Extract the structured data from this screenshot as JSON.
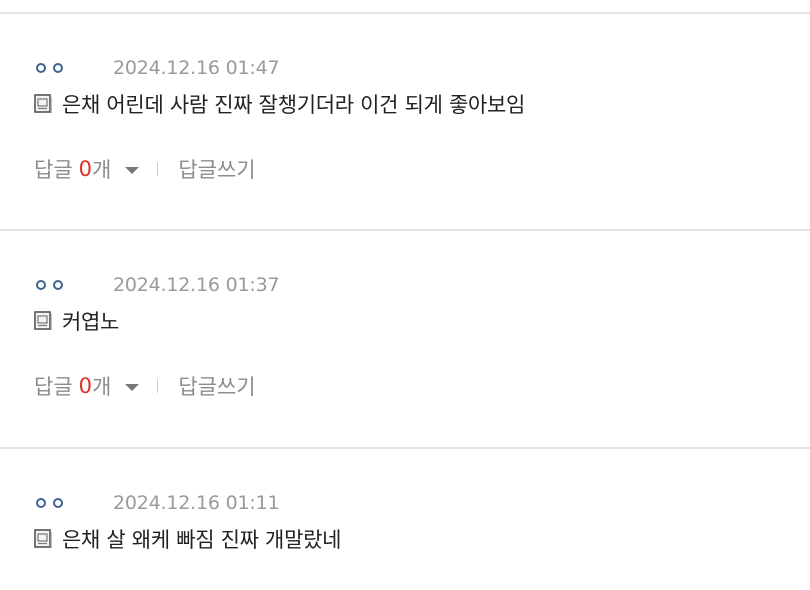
{
  "comments": [
    {
      "nickname": "ㅇㅇ",
      "date": "2024.12.16 01:47",
      "text": "은채 어린데 사람 진짜 잘챙기더라 이건 되게 좋아보임",
      "reply_label": "답글",
      "reply_count": "0",
      "reply_unit": "개",
      "write_reply": "답글쓰기",
      "has_actions": true
    },
    {
      "nickname": "ㅇㅇ",
      "date": "2024.12.16 01:37",
      "text": "커엽노",
      "reply_label": "답글",
      "reply_count": "0",
      "reply_unit": "개",
      "write_reply": "답글쓰기",
      "has_actions": true
    },
    {
      "nickname": "ㅇㅇ",
      "date": "2024.12.16 01:11",
      "text": "은채 살 왜케 빠짐 진짜 개말랐네"
    }
  ],
  "colors": {
    "nickname": "#3d5f8c",
    "date": "#9a9a9a",
    "body_text": "#222222",
    "muted": "#8c8c8c",
    "reply_count": "#e0302b",
    "divider": "#e3e3e3"
  },
  "icons": {
    "comment_marker": "document-icon",
    "reply_toggle": "caret-down-icon"
  }
}
